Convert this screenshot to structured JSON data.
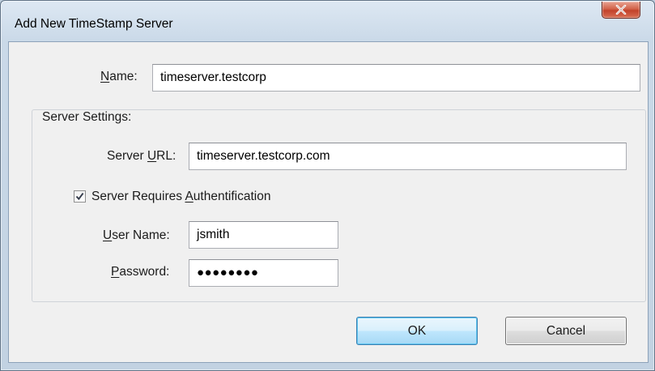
{
  "window": {
    "title": "Add New TimeStamp Server"
  },
  "form": {
    "name": {
      "underline": "N",
      "rest": "ame:",
      "value": "timeserver.testcorp"
    },
    "server_settings": {
      "legend": "Server Settings:",
      "url": {
        "prefix": "Server ",
        "underline": "U",
        "rest": "RL:",
        "value": "timeserver.testcorp.com"
      },
      "auth_checkbox": {
        "prefix": "Server Requires ",
        "underline": "A",
        "rest": "uthentification",
        "checked": true
      },
      "username": {
        "underline": "U",
        "rest": "ser Name:",
        "value": "jsmith"
      },
      "password": {
        "underline": "P",
        "rest": "assword:",
        "masked_value": "●●●●●●●●"
      }
    }
  },
  "buttons": {
    "ok": "OK",
    "cancel": "Cancel"
  },
  "icons": {
    "close": "close-x-icon",
    "check": "checkmark-icon"
  }
}
